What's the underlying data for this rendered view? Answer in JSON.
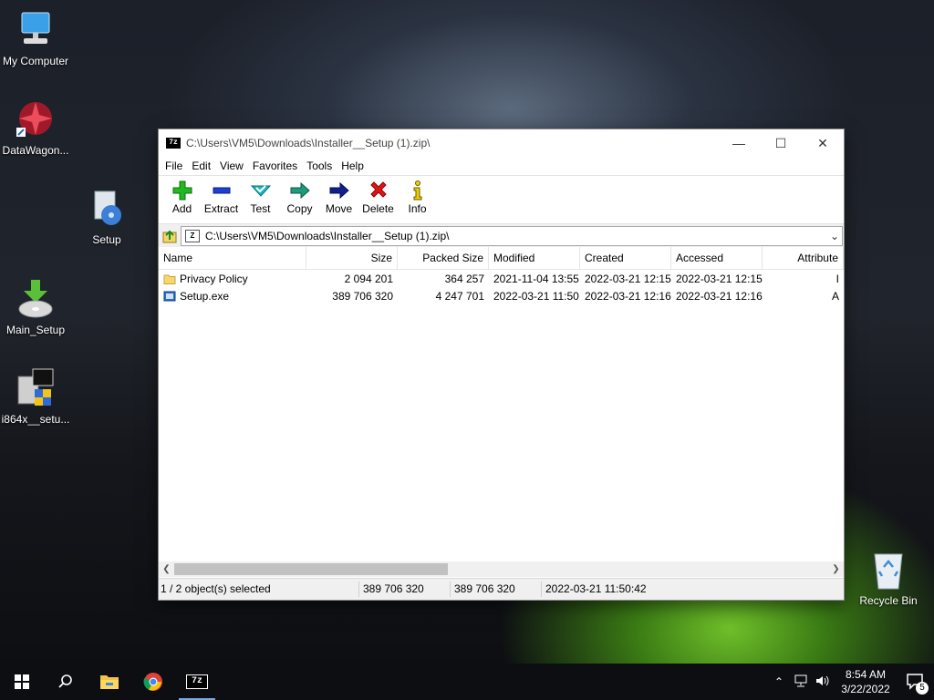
{
  "desktop": {
    "icons": [
      {
        "label": "My Computer"
      },
      {
        "label": "DataWagon..."
      },
      {
        "label": "Setup"
      },
      {
        "label": "Main_Setup"
      },
      {
        "label": "i864x__setu..."
      },
      {
        "label": "Recycle Bin"
      }
    ]
  },
  "window": {
    "app_icon": "7z",
    "title": "C:\\Users\\VM5\\Downloads\\Installer__Setup (1).zip\\",
    "controls": {
      "minimize": "—",
      "maximize": "☐",
      "close": "✕"
    },
    "menu": [
      "File",
      "Edit",
      "View",
      "Favorites",
      "Tools",
      "Help"
    ],
    "toolbar": [
      {
        "label": "Add",
        "icon": "add-icon"
      },
      {
        "label": "Extract",
        "icon": "extract-icon"
      },
      {
        "label": "Test",
        "icon": "test-icon"
      },
      {
        "label": "Copy",
        "icon": "copy-icon"
      },
      {
        "label": "Move",
        "icon": "move-icon"
      },
      {
        "label": "Delete",
        "icon": "delete-icon"
      },
      {
        "label": "Info",
        "icon": "info-icon"
      }
    ],
    "address": {
      "path": "C:\\Users\\VM5\\Downloads\\Installer__Setup (1).zip\\",
      "zip_icon": "Z"
    },
    "columns": [
      "Name",
      "Size",
      "Packed Size",
      "Modified",
      "Created",
      "Accessed",
      "Attribute"
    ],
    "rows": [
      {
        "name": "Privacy Policy",
        "type": "folder",
        "size": "2 094 201",
        "packed": "364 257",
        "modified": "2021-11-04 13:55",
        "created": "2022-03-21 12:15",
        "accessed": "2022-03-21 12:15",
        "attr": "I"
      },
      {
        "name": "Setup.exe",
        "type": "exe",
        "size": "389 706 320",
        "packed": "4 247 701",
        "modified": "2022-03-21 11:50",
        "created": "2022-03-21 12:16",
        "accessed": "2022-03-21 12:16",
        "attr": "A"
      }
    ],
    "status": {
      "selection": "1 / 2 object(s) selected",
      "size": "389 706 320",
      "packed": "389 706 320",
      "date": "2022-03-21 11:50:42"
    }
  },
  "taskbar": {
    "time": "8:54 AM",
    "date": "3/22/2022",
    "notifications": "5",
    "apps": [
      {
        "name": "start-icon"
      },
      {
        "name": "search-icon"
      },
      {
        "name": "file-explorer-icon"
      },
      {
        "name": "chrome-icon"
      },
      {
        "name": "7zip-icon",
        "label": "7z"
      }
    ]
  }
}
